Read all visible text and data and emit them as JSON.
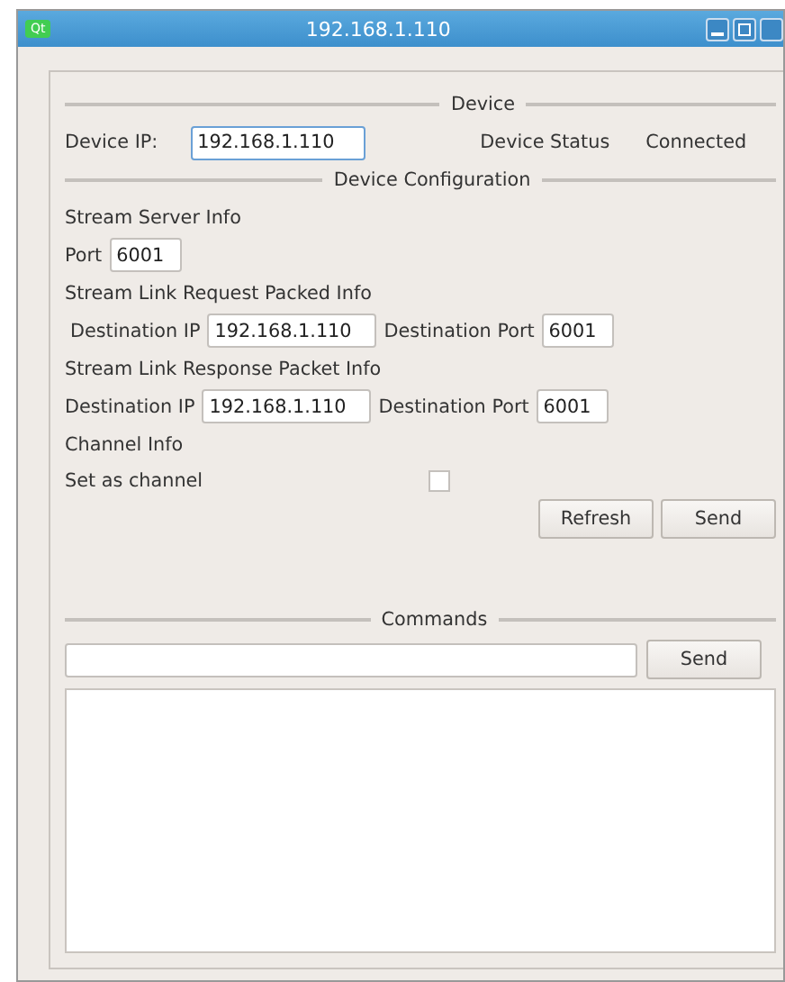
{
  "window": {
    "title": "192.168.1.110",
    "logo": "Qt"
  },
  "device": {
    "heading": "Device",
    "ip_label": "Device IP:",
    "ip_value": "192.168.1.110",
    "status_label": "Device Status",
    "status_value": "Connected"
  },
  "configuration": {
    "heading": "Device Configuration",
    "stream_server": {
      "heading": "Stream Server Info",
      "port_label": "Port",
      "port_value": "6001"
    },
    "request": {
      "heading": "Stream Link Request Packed Info",
      "ip_label": "Destination IP",
      "ip_value": "192.168.1.110",
      "port_label": "Destination Port",
      "port_value": "6001"
    },
    "response": {
      "heading": "Stream Link Response Packet Info",
      "ip_label": "Destination IP",
      "ip_value": "192.168.1.110",
      "port_label": "Destination Port",
      "port_value": "6001"
    },
    "channel": {
      "heading": "Channel Info",
      "label": "Set as channel",
      "checked": false
    },
    "buttons": [
      "Refresh",
      "Send"
    ]
  },
  "commands": {
    "heading": "Commands",
    "button": "Send"
  }
}
